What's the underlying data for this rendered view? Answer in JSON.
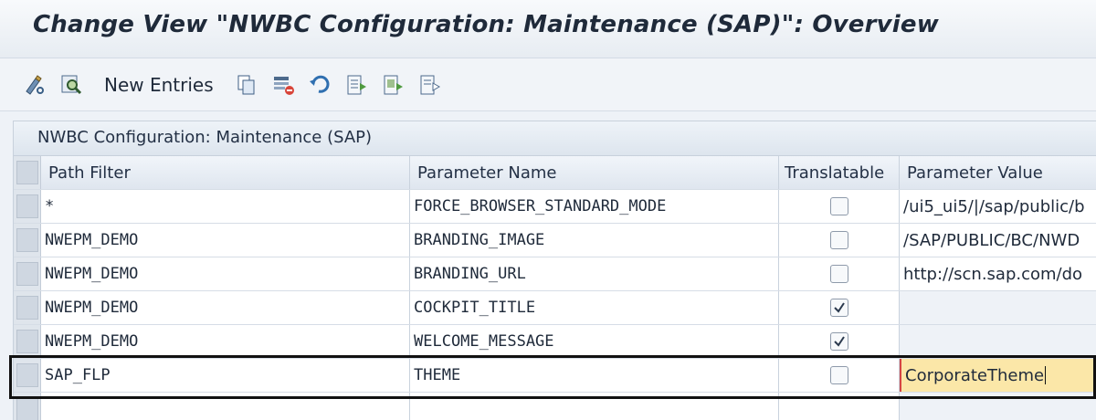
{
  "window": {
    "title": "Change View \"NWBC Configuration: Maintenance (SAP)\": Overview"
  },
  "toolbar": {
    "new_entries_label": "New Entries",
    "icons": [
      "edit-display-icon",
      "find-icon",
      "copy-icon",
      "delete-icon",
      "undo-icon",
      "select-all-icon",
      "select-block-icon",
      "deselect-all-icon"
    ]
  },
  "panel": {
    "title": "NWBC Configuration: Maintenance (SAP)"
  },
  "table": {
    "columns": [
      "Path Filter",
      "Parameter Name",
      "Translatable",
      "Parameter Value"
    ],
    "rows": [
      {
        "path_filter": "*",
        "parameter_name": "FORCE_BROWSER_STANDARD_MODE",
        "translatable": false,
        "parameter_value": "/ui5_ui5/|/sap/public/b"
      },
      {
        "path_filter": "NWEPM_DEMO",
        "parameter_name": "BRANDING_IMAGE",
        "translatable": false,
        "parameter_value": "/SAP/PUBLIC/BC/NWD"
      },
      {
        "path_filter": "NWEPM_DEMO",
        "parameter_name": "BRANDING_URL",
        "translatable": false,
        "parameter_value": "http://scn.sap.com/do"
      },
      {
        "path_filter": "NWEPM_DEMO",
        "parameter_name": "COCKPIT_TITLE",
        "translatable": true,
        "parameter_value": ""
      },
      {
        "path_filter": "NWEPM_DEMO",
        "parameter_name": "WELCOME_MESSAGE",
        "translatable": true,
        "parameter_value": ""
      },
      {
        "path_filter": "SAP_FLP",
        "parameter_name": "THEME",
        "translatable": false,
        "parameter_value": "CorporateTheme"
      }
    ]
  },
  "colors": {
    "title_text": "#1f2a3a",
    "highlight_border": "#111111",
    "editing_background": "#fbe7a8",
    "editing_marker": "#d64545"
  }
}
